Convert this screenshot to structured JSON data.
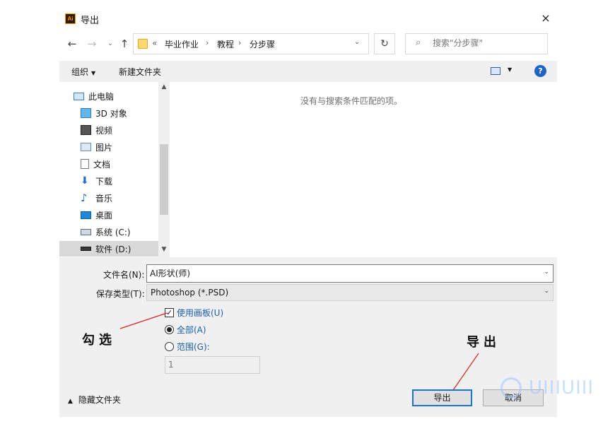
{
  "window": {
    "title": "导出",
    "app_icon": "Ai",
    "close": "×"
  },
  "nav": {
    "back": "←",
    "forward": "→",
    "recent": "⌄",
    "up": "↑",
    "refresh": "↻"
  },
  "address": {
    "more": "«",
    "crumbs": [
      "毕业作业",
      "教程",
      "分步骤"
    ],
    "separator": "›",
    "dropdown": "⌄"
  },
  "search": {
    "placeholder": "搜索\"分步骤\"",
    "icon": "search-icon"
  },
  "toolbar": {
    "organize": "组织",
    "caret": "▼",
    "new_folder": "新建文件夹",
    "help": "?"
  },
  "tree": {
    "items": [
      {
        "label": "此电脑",
        "icon": "computer-icon"
      },
      {
        "label": "3D 对象",
        "icon": "cube-icon"
      },
      {
        "label": "视频",
        "icon": "film-icon"
      },
      {
        "label": "图片",
        "icon": "picture-icon"
      },
      {
        "label": "文档",
        "icon": "document-icon"
      },
      {
        "label": "下载",
        "icon": "download-icon"
      },
      {
        "label": "音乐",
        "icon": "music-icon"
      },
      {
        "label": "桌面",
        "icon": "desktop-icon"
      },
      {
        "label": "系统 (C:)",
        "icon": "drive-c-icon"
      },
      {
        "label": "软件 (D:)",
        "icon": "drive-d-icon"
      }
    ],
    "scroll_up": "▲",
    "scroll_down": "▼"
  },
  "content": {
    "empty_message": "没有与搜索条件匹配的项。"
  },
  "form": {
    "filename_label": "文件名(N):",
    "filename_value": "AI形状(师)",
    "filetype_label": "保存类型(T):",
    "filetype_value": "Photoshop (*.PSD)",
    "caret": "⌄",
    "use_artboards_label": "使用画板(U)",
    "use_artboards_checked": true,
    "check_mark": "✓",
    "all_label": "全部(A)",
    "range_label": "范围(G):",
    "range_value": "1",
    "hide_folders": "隐藏文件夹",
    "hide_caret": "▲",
    "export_button": "导出",
    "cancel_button": "取消"
  },
  "annotations": {
    "check": "勾选",
    "export": "导出"
  },
  "watermark": {
    "text": "UIIIUIII"
  },
  "colors": {
    "accent": "#1a73d8",
    "link": "#1a5fb4",
    "annotation_line": "#e02020",
    "help": "#1e64c8"
  }
}
